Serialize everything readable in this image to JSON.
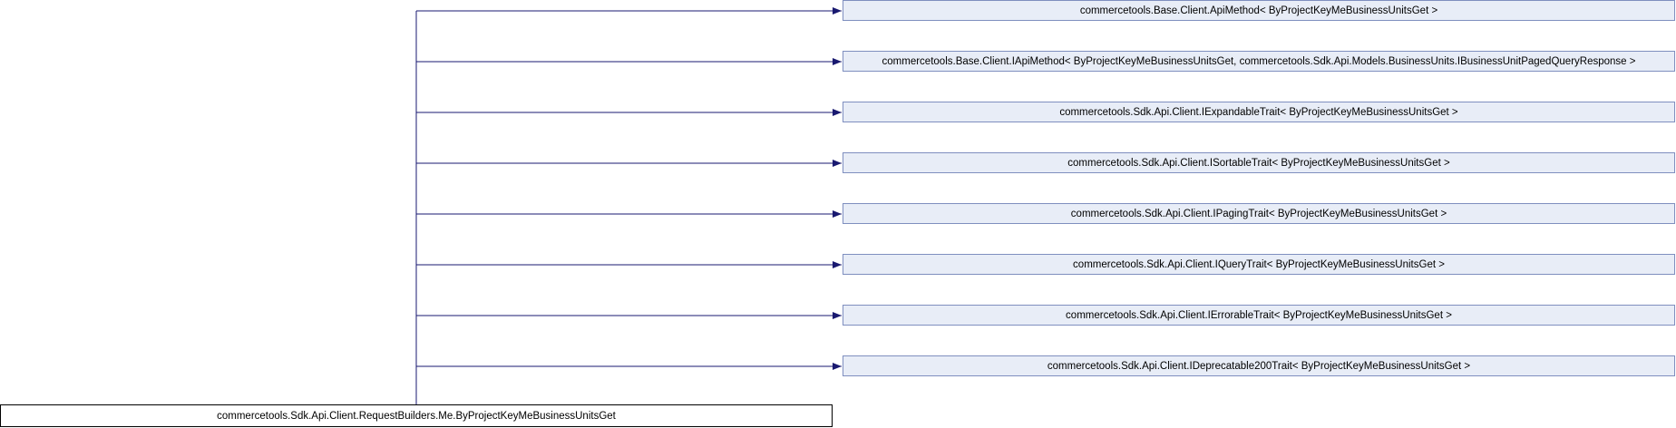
{
  "derived_class": {
    "label": "commercetools.Sdk.Api.Client.RequestBuilders.Me.ByProjectKeyMeBusinessUnitsGet"
  },
  "base_classes": [
    {
      "label": "commercetools.Base.Client.ApiMethod< ByProjectKeyMeBusinessUnitsGet >"
    },
    {
      "label": "commercetools.Base.Client.IApiMethod< ByProjectKeyMeBusinessUnitsGet, commercetools.Sdk.Api.Models.BusinessUnits.IBusinessUnitPagedQueryResponse >"
    },
    {
      "label": "commercetools.Sdk.Api.Client.IExpandableTrait< ByProjectKeyMeBusinessUnitsGet >"
    },
    {
      "label": "commercetools.Sdk.Api.Client.ISortableTrait< ByProjectKeyMeBusinessUnitsGet >"
    },
    {
      "label": "commercetools.Sdk.Api.Client.IPagingTrait< ByProjectKeyMeBusinessUnitsGet >"
    },
    {
      "label": "commercetools.Sdk.Api.Client.IQueryTrait< ByProjectKeyMeBusinessUnitsGet >"
    },
    {
      "label": "commercetools.Sdk.Api.Client.IErrorableTrait< ByProjectKeyMeBusinessUnitsGet >"
    },
    {
      "label": "commercetools.Sdk.Api.Client.IDeprecatable200Trait< ByProjectKeyMeBusinessUnitsGet >"
    }
  ],
  "colors": {
    "edge": "#191970",
    "base_fill": "#e8edf7",
    "base_border": "#7f8fbf",
    "derived_border": "#000000"
  }
}
